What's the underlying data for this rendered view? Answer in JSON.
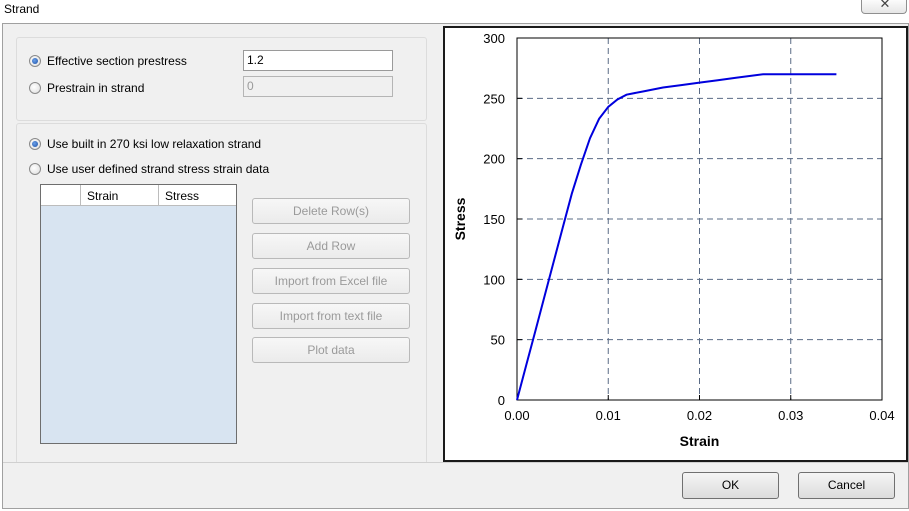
{
  "window": {
    "title": "Strand",
    "close_glyph": "✕"
  },
  "prestress": {
    "effective_label": "Effective section prestress",
    "effective_value": "1.2",
    "prestrain_label": "Prestrain in strand",
    "prestrain_value": "0",
    "selected": "effective"
  },
  "strand_source": {
    "builtin_label": "Use built in 270 ksi low relaxation strand",
    "user_label": "Use user defined strand stress strain data",
    "selected": "builtin"
  },
  "table": {
    "columns": [
      "",
      "Strain",
      "Stress"
    ],
    "rows": []
  },
  "buttons": {
    "delete_rows": "Delete Row(s)",
    "add_row": "Add Row",
    "import_excel": "Import from Excel file",
    "import_text": "Import from text file",
    "plot_data": "Plot data",
    "ok": "OK",
    "cancel": "Cancel"
  },
  "chart_data": {
    "type": "line",
    "title": "",
    "xlabel": "Strain",
    "ylabel": "Stress",
    "xlim": [
      0,
      0.04
    ],
    "ylim": [
      0,
      300
    ],
    "xticks": [
      "0.00",
      "0.01",
      "0.02",
      "0.03",
      "0.04"
    ],
    "yticks": [
      "0",
      "50",
      "100",
      "150",
      "200",
      "250",
      "300"
    ],
    "grid": true,
    "grid_style": "dashed",
    "line_color": "#0000dd",
    "series": [
      {
        "x": [
          0,
          0.001,
          0.002,
          0.003,
          0.004,
          0.005,
          0.006,
          0.007,
          0.008,
          0.009,
          0.01,
          0.011,
          0.012,
          0.014,
          0.016,
          0.018,
          0.02,
          0.022,
          0.024,
          0.027,
          0.03,
          0.035
        ],
        "y": [
          0,
          28.5,
          57,
          85.5,
          114,
          142.5,
          171,
          195,
          217,
          233,
          243,
          249,
          253,
          256,
          259,
          261,
          263,
          265,
          267,
          270,
          270,
          270
        ]
      }
    ]
  }
}
